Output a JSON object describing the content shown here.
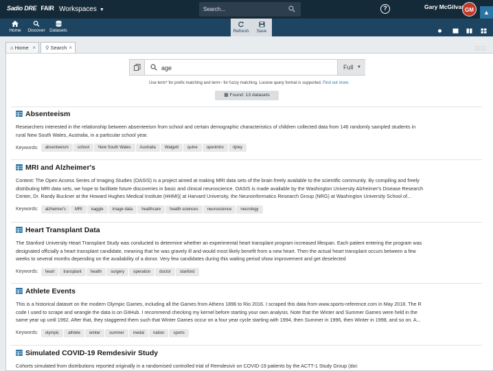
{
  "topbar": {
    "logo": "Sadio DRE",
    "logo_fair": "FAIR",
    "workspaces": "Workspaces",
    "search_placeholder": "Search...",
    "help": "?",
    "user_name": "Gary McGilvary",
    "user_initials": "GM"
  },
  "toolbar": {
    "home": "Home",
    "discover": "Discover",
    "datasets": "Datasets",
    "refresh": "Refresh",
    "save": "Save"
  },
  "tabs": [
    {
      "label": "Home"
    },
    {
      "label": "Search"
    }
  ],
  "search": {
    "query": "age",
    "mode": "Full",
    "hint": "Use term* for prefix matching and term~ for fuzzy matching. Lucene query format is supported.",
    "hint_link": "Find out more.",
    "found": "Found: 13 datasets"
  },
  "keywords_label": "Keywords:",
  "results": [
    {
      "title": "Absenteeism",
      "desc": [
        "Researchers interested in the relationship between absenteeism from school and certain demographic characteristics of children collected data from 146 randomly sampled students in",
        "rural New South Wales, Australia, in a particular school year."
      ],
      "keywords": [
        "absenteeism",
        "school",
        "New South Wales",
        "Australia",
        "Walgett",
        "quine",
        "openintro",
        "ripley"
      ]
    },
    {
      "title": "MRI and Alzheimer's",
      "desc": [
        "Context: The Open Access Series of Imaging Studies (OASIS) is a project aimed at making MRI data sets of the brain freely available to the scientific community. By compiling and freely",
        "distributing MRI data sets, we hope to facilitate future discoveries in basic and clinical neuroscience. OASIS is made available by the Washington University Alzheimer's Disease Research",
        "Center, Dr. Randy Buckner at the Howard Hughes Medical Institute (HHMI)( at Harvard University, the Neuroinformatics Research Group (NRG) at Washington University School of..."
      ],
      "keywords": [
        "alzheimer's",
        "MRI",
        "kaggle",
        "image data",
        "healthcare",
        "health sciences",
        "neuroscience",
        "neurology"
      ]
    },
    {
      "title": "Heart Transplant Data",
      "desc": [
        "The Stanford University Heart Transplant Study was conducted to determine whether an experimental heart transplant program increased lifespan. Each patient entering the program was",
        "designated officially a heart transplant candidate, meaning that he was gravely ill and would most likely benefit from a new heart. Then the actual heart transplant occurs between a few",
        "weeks to several months depending on the availability of a donor. Very few candidates during this waiting period show improvement and get deselected"
      ],
      "keywords": [
        "heart",
        "transplant",
        "health",
        "surgery",
        "operation",
        "doctor",
        "stanford"
      ]
    },
    {
      "title": "Athlete Events",
      "desc": [
        "This is a historical dataset on the modern Olympic Games, including all the Games from Athens 1896 to Rio 2016. I scraped this data from www.sports-reference.com in May 2018. The R",
        "code I used to scrape and wrangle the data is on GitHub. I recommend checking my kernel before starting your own analysis. Note that the Winter and Summer Games were held in the",
        "same year up until 1992. After that, they staggered them such that Winter Games occur on a four year cycle starting with 1994, then Summer in 1996, then Winter in 1998, and so on. A..."
      ],
      "keywords": [
        "olympic",
        "athlete",
        "winter",
        "summer",
        "medal",
        "nation",
        "sports"
      ]
    },
    {
      "title": "Simulated COVID-19 Remdesivir Study",
      "desc": [
        "Cohorts simulated from distributions reported originally in a randomised controlled trial of Remdesivir on COVID-19 patients by the ACTT-1 Study Group (doi:"
      ],
      "keywords": []
    }
  ]
}
